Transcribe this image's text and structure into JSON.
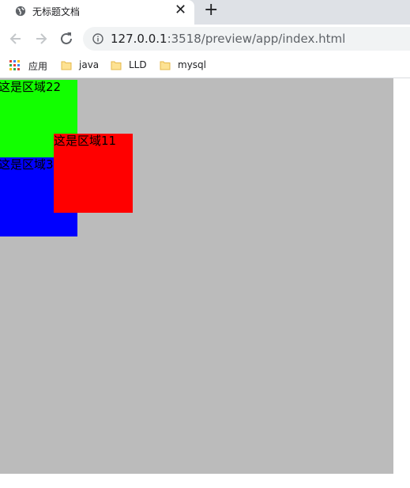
{
  "tab": {
    "title": "无标题文档",
    "close": "✕",
    "new_tab": "+"
  },
  "toolbar": {
    "url_host": "127.0.0.1",
    "url_rest": ":3518/preview/app/index.html"
  },
  "bookmarks": [
    {
      "label": "应用",
      "icon": "apps-grid-icon"
    },
    {
      "label": "java",
      "icon": "folder-icon"
    },
    {
      "label": "LLD",
      "icon": "folder-icon"
    },
    {
      "label": "mysql",
      "icon": "folder-icon"
    }
  ],
  "page": {
    "boxes": [
      {
        "text": "这是区域22",
        "color": "#12ff00"
      },
      {
        "text": "这是区域33",
        "color": "#0000ff"
      },
      {
        "text": "这是区域11",
        "color": "#ff0000"
      }
    ],
    "container_color": "#bbbbbb"
  }
}
